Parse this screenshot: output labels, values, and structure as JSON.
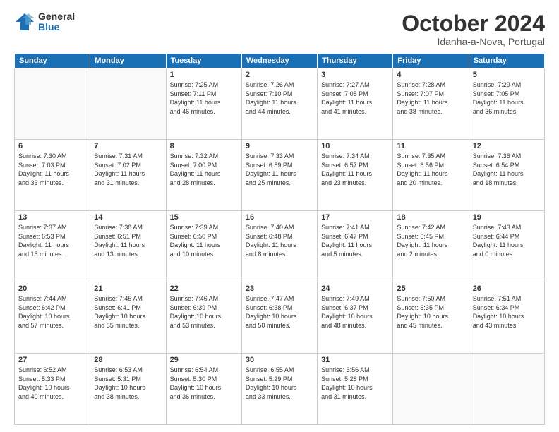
{
  "logo": {
    "general": "General",
    "blue": "Blue"
  },
  "title": "October 2024",
  "subtitle": "Idanha-a-Nova, Portugal",
  "weekdays": [
    "Sunday",
    "Monday",
    "Tuesday",
    "Wednesday",
    "Thursday",
    "Friday",
    "Saturday"
  ],
  "weeks": [
    [
      {
        "day": null,
        "info": ""
      },
      {
        "day": null,
        "info": ""
      },
      {
        "day": "1",
        "info": "Sunrise: 7:25 AM\nSunset: 7:11 PM\nDaylight: 11 hours\nand 46 minutes."
      },
      {
        "day": "2",
        "info": "Sunrise: 7:26 AM\nSunset: 7:10 PM\nDaylight: 11 hours\nand 44 minutes."
      },
      {
        "day": "3",
        "info": "Sunrise: 7:27 AM\nSunset: 7:08 PM\nDaylight: 11 hours\nand 41 minutes."
      },
      {
        "day": "4",
        "info": "Sunrise: 7:28 AM\nSunset: 7:07 PM\nDaylight: 11 hours\nand 38 minutes."
      },
      {
        "day": "5",
        "info": "Sunrise: 7:29 AM\nSunset: 7:05 PM\nDaylight: 11 hours\nand 36 minutes."
      }
    ],
    [
      {
        "day": "6",
        "info": "Sunrise: 7:30 AM\nSunset: 7:03 PM\nDaylight: 11 hours\nand 33 minutes."
      },
      {
        "day": "7",
        "info": "Sunrise: 7:31 AM\nSunset: 7:02 PM\nDaylight: 11 hours\nand 31 minutes."
      },
      {
        "day": "8",
        "info": "Sunrise: 7:32 AM\nSunset: 7:00 PM\nDaylight: 11 hours\nand 28 minutes."
      },
      {
        "day": "9",
        "info": "Sunrise: 7:33 AM\nSunset: 6:59 PM\nDaylight: 11 hours\nand 25 minutes."
      },
      {
        "day": "10",
        "info": "Sunrise: 7:34 AM\nSunset: 6:57 PM\nDaylight: 11 hours\nand 23 minutes."
      },
      {
        "day": "11",
        "info": "Sunrise: 7:35 AM\nSunset: 6:56 PM\nDaylight: 11 hours\nand 20 minutes."
      },
      {
        "day": "12",
        "info": "Sunrise: 7:36 AM\nSunset: 6:54 PM\nDaylight: 11 hours\nand 18 minutes."
      }
    ],
    [
      {
        "day": "13",
        "info": "Sunrise: 7:37 AM\nSunset: 6:53 PM\nDaylight: 11 hours\nand 15 minutes."
      },
      {
        "day": "14",
        "info": "Sunrise: 7:38 AM\nSunset: 6:51 PM\nDaylight: 11 hours\nand 13 minutes."
      },
      {
        "day": "15",
        "info": "Sunrise: 7:39 AM\nSunset: 6:50 PM\nDaylight: 11 hours\nand 10 minutes."
      },
      {
        "day": "16",
        "info": "Sunrise: 7:40 AM\nSunset: 6:48 PM\nDaylight: 11 hours\nand 8 minutes."
      },
      {
        "day": "17",
        "info": "Sunrise: 7:41 AM\nSunset: 6:47 PM\nDaylight: 11 hours\nand 5 minutes."
      },
      {
        "day": "18",
        "info": "Sunrise: 7:42 AM\nSunset: 6:45 PM\nDaylight: 11 hours\nand 2 minutes."
      },
      {
        "day": "19",
        "info": "Sunrise: 7:43 AM\nSunset: 6:44 PM\nDaylight: 11 hours\nand 0 minutes."
      }
    ],
    [
      {
        "day": "20",
        "info": "Sunrise: 7:44 AM\nSunset: 6:42 PM\nDaylight: 10 hours\nand 57 minutes."
      },
      {
        "day": "21",
        "info": "Sunrise: 7:45 AM\nSunset: 6:41 PM\nDaylight: 10 hours\nand 55 minutes."
      },
      {
        "day": "22",
        "info": "Sunrise: 7:46 AM\nSunset: 6:39 PM\nDaylight: 10 hours\nand 53 minutes."
      },
      {
        "day": "23",
        "info": "Sunrise: 7:47 AM\nSunset: 6:38 PM\nDaylight: 10 hours\nand 50 minutes."
      },
      {
        "day": "24",
        "info": "Sunrise: 7:49 AM\nSunset: 6:37 PM\nDaylight: 10 hours\nand 48 minutes."
      },
      {
        "day": "25",
        "info": "Sunrise: 7:50 AM\nSunset: 6:35 PM\nDaylight: 10 hours\nand 45 minutes."
      },
      {
        "day": "26",
        "info": "Sunrise: 7:51 AM\nSunset: 6:34 PM\nDaylight: 10 hours\nand 43 minutes."
      }
    ],
    [
      {
        "day": "27",
        "info": "Sunrise: 6:52 AM\nSunset: 5:33 PM\nDaylight: 10 hours\nand 40 minutes."
      },
      {
        "day": "28",
        "info": "Sunrise: 6:53 AM\nSunset: 5:31 PM\nDaylight: 10 hours\nand 38 minutes."
      },
      {
        "day": "29",
        "info": "Sunrise: 6:54 AM\nSunset: 5:30 PM\nDaylight: 10 hours\nand 36 minutes."
      },
      {
        "day": "30",
        "info": "Sunrise: 6:55 AM\nSunset: 5:29 PM\nDaylight: 10 hours\nand 33 minutes."
      },
      {
        "day": "31",
        "info": "Sunrise: 6:56 AM\nSunset: 5:28 PM\nDaylight: 10 hours\nand 31 minutes."
      },
      {
        "day": null,
        "info": ""
      },
      {
        "day": null,
        "info": ""
      }
    ]
  ]
}
